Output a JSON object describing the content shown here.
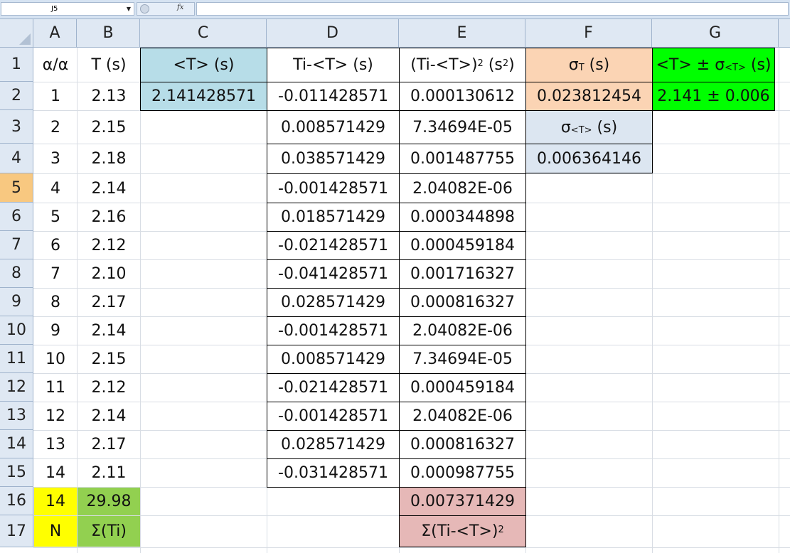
{
  "name_box": "J5",
  "formula_bar": {
    "fx_label": "fx",
    "content": ""
  },
  "colors": {
    "header_bg": "#dfe8f3",
    "active_row": "#f8c880",
    "light_blue": "#b7dde8",
    "peach": "#fbd4b4",
    "pale_blue": "#dce6f1",
    "green": "#00ff00",
    "yellow": "#ffff00",
    "lime": "#92d050",
    "pink": "#e6b8b7"
  },
  "columns": [
    "A",
    "B",
    "C",
    "D",
    "E",
    "F",
    "G"
  ],
  "rows": [
    "1",
    "2",
    "3",
    "4",
    "5",
    "6",
    "7",
    "8",
    "9",
    "10",
    "11",
    "12",
    "13",
    "14",
    "15",
    "16",
    "17"
  ],
  "active_row": "5",
  "headers": {
    "A": "α/α",
    "B": "T (s)",
    "C": "<T> (s)",
    "D": "Ti-<T> (s)",
    "E": {
      "base": "(Ti-<T>)",
      "exp": "2",
      "mid": " (s",
      "unit_exp": "2",
      "end": ")"
    },
    "F": {
      "sym": "σ",
      "sub": "T",
      "end": " (s)"
    },
    "G": {
      "pre": "<T> ± σ",
      "sub": "<T>",
      "end": " (s)"
    }
  },
  "A_values": [
    "1",
    "2",
    "3",
    "4",
    "5",
    "6",
    "7",
    "8",
    "9",
    "10",
    "11",
    "12",
    "13",
    "14"
  ],
  "B_values": [
    "2.13",
    "2.15",
    "2.18",
    "2.14",
    "2.16",
    "2.12",
    "2.10",
    "2.17",
    "2.14",
    "2.15",
    "2.12",
    "2.14",
    "2.17",
    "2.11"
  ],
  "D_values": [
    "-0.011428571",
    "0.008571429",
    "0.038571429",
    "-0.001428571",
    "0.018571429",
    "-0.021428571",
    "-0.041428571",
    "0.028571429",
    "-0.001428571",
    "0.008571429",
    "-0.021428571",
    "-0.001428571",
    "0.028571429",
    "-0.031428571"
  ],
  "E_values": [
    "0.000130612",
    "7.34694E-05",
    "0.001487755",
    "2.04082E-06",
    "0.000344898",
    "0.000459184",
    "0.001716327",
    "0.000816327",
    "2.04082E-06",
    "7.34694E-05",
    "0.000459184",
    "2.04082E-06",
    "0.000816327",
    "0.000987755"
  ],
  "C2": "2.141428571",
  "F2": "0.023812454",
  "F3": {
    "sym": "σ",
    "sub": "<T>",
    "end": " (s)"
  },
  "F4": "0.006364146",
  "G2": "2.141 ± 0.006",
  "A16": "14",
  "B16": "29.98",
  "E16": "0.007371429",
  "A17": "N",
  "B17": "Σ(Ti)",
  "E17": {
    "base": "Σ(Ti-<T>)",
    "exp": "2"
  }
}
